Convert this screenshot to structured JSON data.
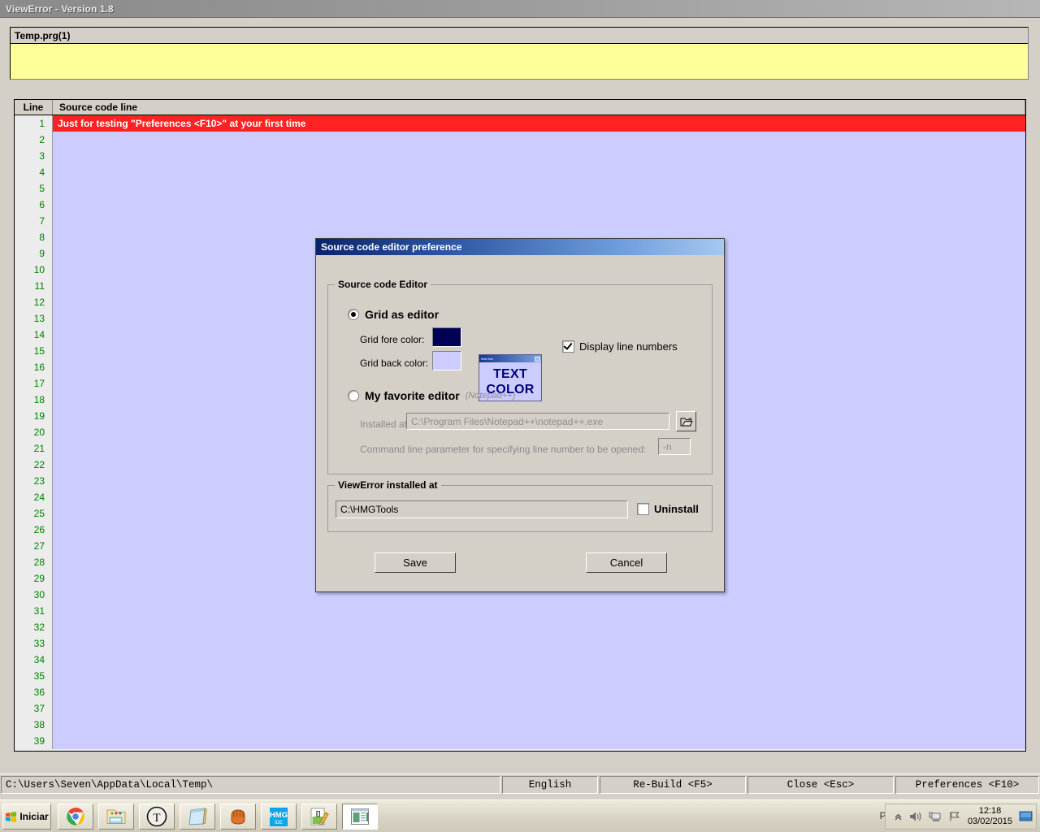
{
  "window": {
    "title": "ViewError - Version 1.8"
  },
  "message_panel": {
    "header": "Temp.prg(1)",
    "body": ""
  },
  "grid": {
    "columns": [
      "Line",
      "Source code line"
    ],
    "rows": [
      {
        "line": "1",
        "text": "Just for testing \"Preferences <F10>\" at your first time",
        "error": true
      },
      {
        "line": "2",
        "text": "",
        "error": false
      },
      {
        "line": "3",
        "text": "",
        "error": false
      },
      {
        "line": "4",
        "text": "",
        "error": false
      },
      {
        "line": "5",
        "text": "",
        "error": false
      },
      {
        "line": "6",
        "text": "",
        "error": false
      },
      {
        "line": "7",
        "text": "",
        "error": false
      },
      {
        "line": "8",
        "text": "",
        "error": false
      },
      {
        "line": "9",
        "text": "",
        "error": false
      },
      {
        "line": "10",
        "text": "",
        "error": false
      },
      {
        "line": "11",
        "text": "",
        "error": false
      },
      {
        "line": "12",
        "text": "",
        "error": false
      },
      {
        "line": "13",
        "text": "",
        "error": false
      },
      {
        "line": "14",
        "text": "",
        "error": false
      },
      {
        "line": "15",
        "text": "",
        "error": false
      },
      {
        "line": "16",
        "text": "",
        "error": false
      },
      {
        "line": "17",
        "text": "",
        "error": false
      },
      {
        "line": "18",
        "text": "",
        "error": false
      },
      {
        "line": "19",
        "text": "",
        "error": false
      },
      {
        "line": "20",
        "text": "",
        "error": false
      },
      {
        "line": "21",
        "text": "",
        "error": false
      },
      {
        "line": "22",
        "text": "",
        "error": false
      },
      {
        "line": "23",
        "text": "",
        "error": false
      },
      {
        "line": "24",
        "text": "",
        "error": false
      },
      {
        "line": "25",
        "text": "",
        "error": false
      },
      {
        "line": "26",
        "text": "",
        "error": false
      },
      {
        "line": "27",
        "text": "",
        "error": false
      },
      {
        "line": "28",
        "text": "",
        "error": false
      },
      {
        "line": "29",
        "text": "",
        "error": false
      },
      {
        "line": "30",
        "text": "",
        "error": false
      },
      {
        "line": "31",
        "text": "",
        "error": false
      },
      {
        "line": "32",
        "text": "",
        "error": false
      },
      {
        "line": "33",
        "text": "",
        "error": false
      },
      {
        "line": "34",
        "text": "",
        "error": false
      },
      {
        "line": "35",
        "text": "",
        "error": false
      },
      {
        "line": "36",
        "text": "",
        "error": false
      },
      {
        "line": "37",
        "text": "",
        "error": false
      },
      {
        "line": "38",
        "text": "",
        "error": false
      },
      {
        "line": "39",
        "text": "",
        "error": false
      }
    ]
  },
  "statusbar": {
    "path": "C:\\Users\\Seven\\AppData\\Local\\Temp\\",
    "language": "English",
    "rebuild": "Re-Build <F5>",
    "close": "Close <Esc>",
    "preferences": "Preferences <F10>"
  },
  "dialog": {
    "title": "Source code editor preference",
    "editor_group": {
      "legend": "Source code Editor",
      "grid_option": {
        "label": "Grid as editor",
        "selected": true
      },
      "fore_color_label": "Grid fore color:",
      "fore_color_value": "#000055",
      "back_color_label": "Grid back color:",
      "back_color_value": "#CCCCFF",
      "preview": {
        "titlebar_text": "Note that :",
        "line1": "TEXT",
        "line2": "COLOR"
      },
      "display_line_numbers": {
        "label": "Display line numbers",
        "checked": true
      },
      "favorite_option": {
        "label": "My favorite editor",
        "note": "(Notepad++)",
        "selected": false
      },
      "installed_at_label": "Installed at:",
      "installed_at_value": "C:\\Program Files\\Notepad++\\notepad++.exe",
      "browse_icon": "open-folder-icon",
      "cmdline_label": "Command line parameter for specifying line number to be opened:",
      "cmdline_value": "-n"
    },
    "install_group": {
      "legend": "ViewError installed at",
      "path_value": "C:\\HMGTools",
      "uninstall": {
        "label": "Uninstall",
        "checked": false
      }
    },
    "save_button": "Save",
    "cancel_button": "Cancel"
  },
  "taskbar": {
    "start_label": "Iniciar",
    "items": [
      {
        "name": "chrome-icon"
      },
      {
        "name": "file-explorer-icon"
      },
      {
        "name": "t-circle-icon"
      },
      {
        "name": "notepad-icon"
      },
      {
        "name": "baseball-glove-icon"
      },
      {
        "name": "hmg-ide-icon"
      },
      {
        "name": "editor-pencil-icon"
      },
      {
        "name": "viewerror-window-icon"
      }
    ],
    "tray": {
      "language": "PT",
      "time": "12:18",
      "date": "03/02/2015"
    }
  },
  "colors": {
    "face": "#d4d0c8",
    "grid_back": "#ccccff",
    "grid_fore": "#000055",
    "error_row": "#ff2222",
    "panel_yellow": "#ffff99",
    "line_number": "#008000"
  }
}
